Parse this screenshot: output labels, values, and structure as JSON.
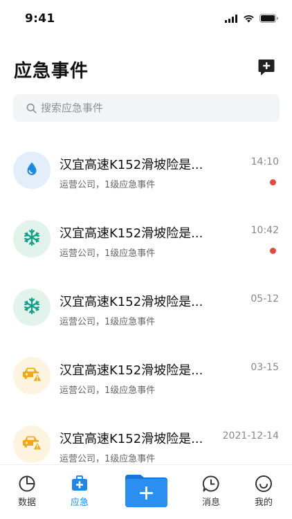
{
  "status_bar": {
    "time": "9:41"
  },
  "header": {
    "title": "应急事件"
  },
  "search": {
    "placeholder": "搜索应急事件"
  },
  "events": [
    {
      "title": "汉宜高速K152滑坡险是...",
      "subtitle": "运营公司，1级应急事件",
      "time": "14:10",
      "unread": true,
      "icon": "water-drop-icon",
      "color": "#1e88e5"
    },
    {
      "title": "汉宜高速K152滑坡险是...",
      "subtitle": "运营公司，1级应急事件",
      "time": "10:42",
      "unread": true,
      "icon": "snowflake-icon",
      "color": "#0f9f86"
    },
    {
      "title": "汉宜高速K152滑坡险是...",
      "subtitle": "运营公司，1级应急事件",
      "time": "05-12",
      "unread": false,
      "icon": "snowflake-icon",
      "color": "#0f9f86"
    },
    {
      "title": "汉宜高速K152滑坡险是...",
      "subtitle": "运营公司，1级应急事件",
      "time": "03-15",
      "unread": false,
      "icon": "car-accident-icon",
      "color": "#f2a714"
    },
    {
      "title": "汉宜高速K152滑坡险是...",
      "subtitle": "运营公司，1级应急事件",
      "time": "2021-12-14",
      "unread": false,
      "icon": "car-accident-icon",
      "color": "#f2a714"
    }
  ],
  "tabbar": {
    "data_label": "数据",
    "emergency_label": "应急",
    "messages_label": "消息",
    "mine_label": "我的",
    "active": "emergency",
    "accent_color": "#1e88e5"
  }
}
